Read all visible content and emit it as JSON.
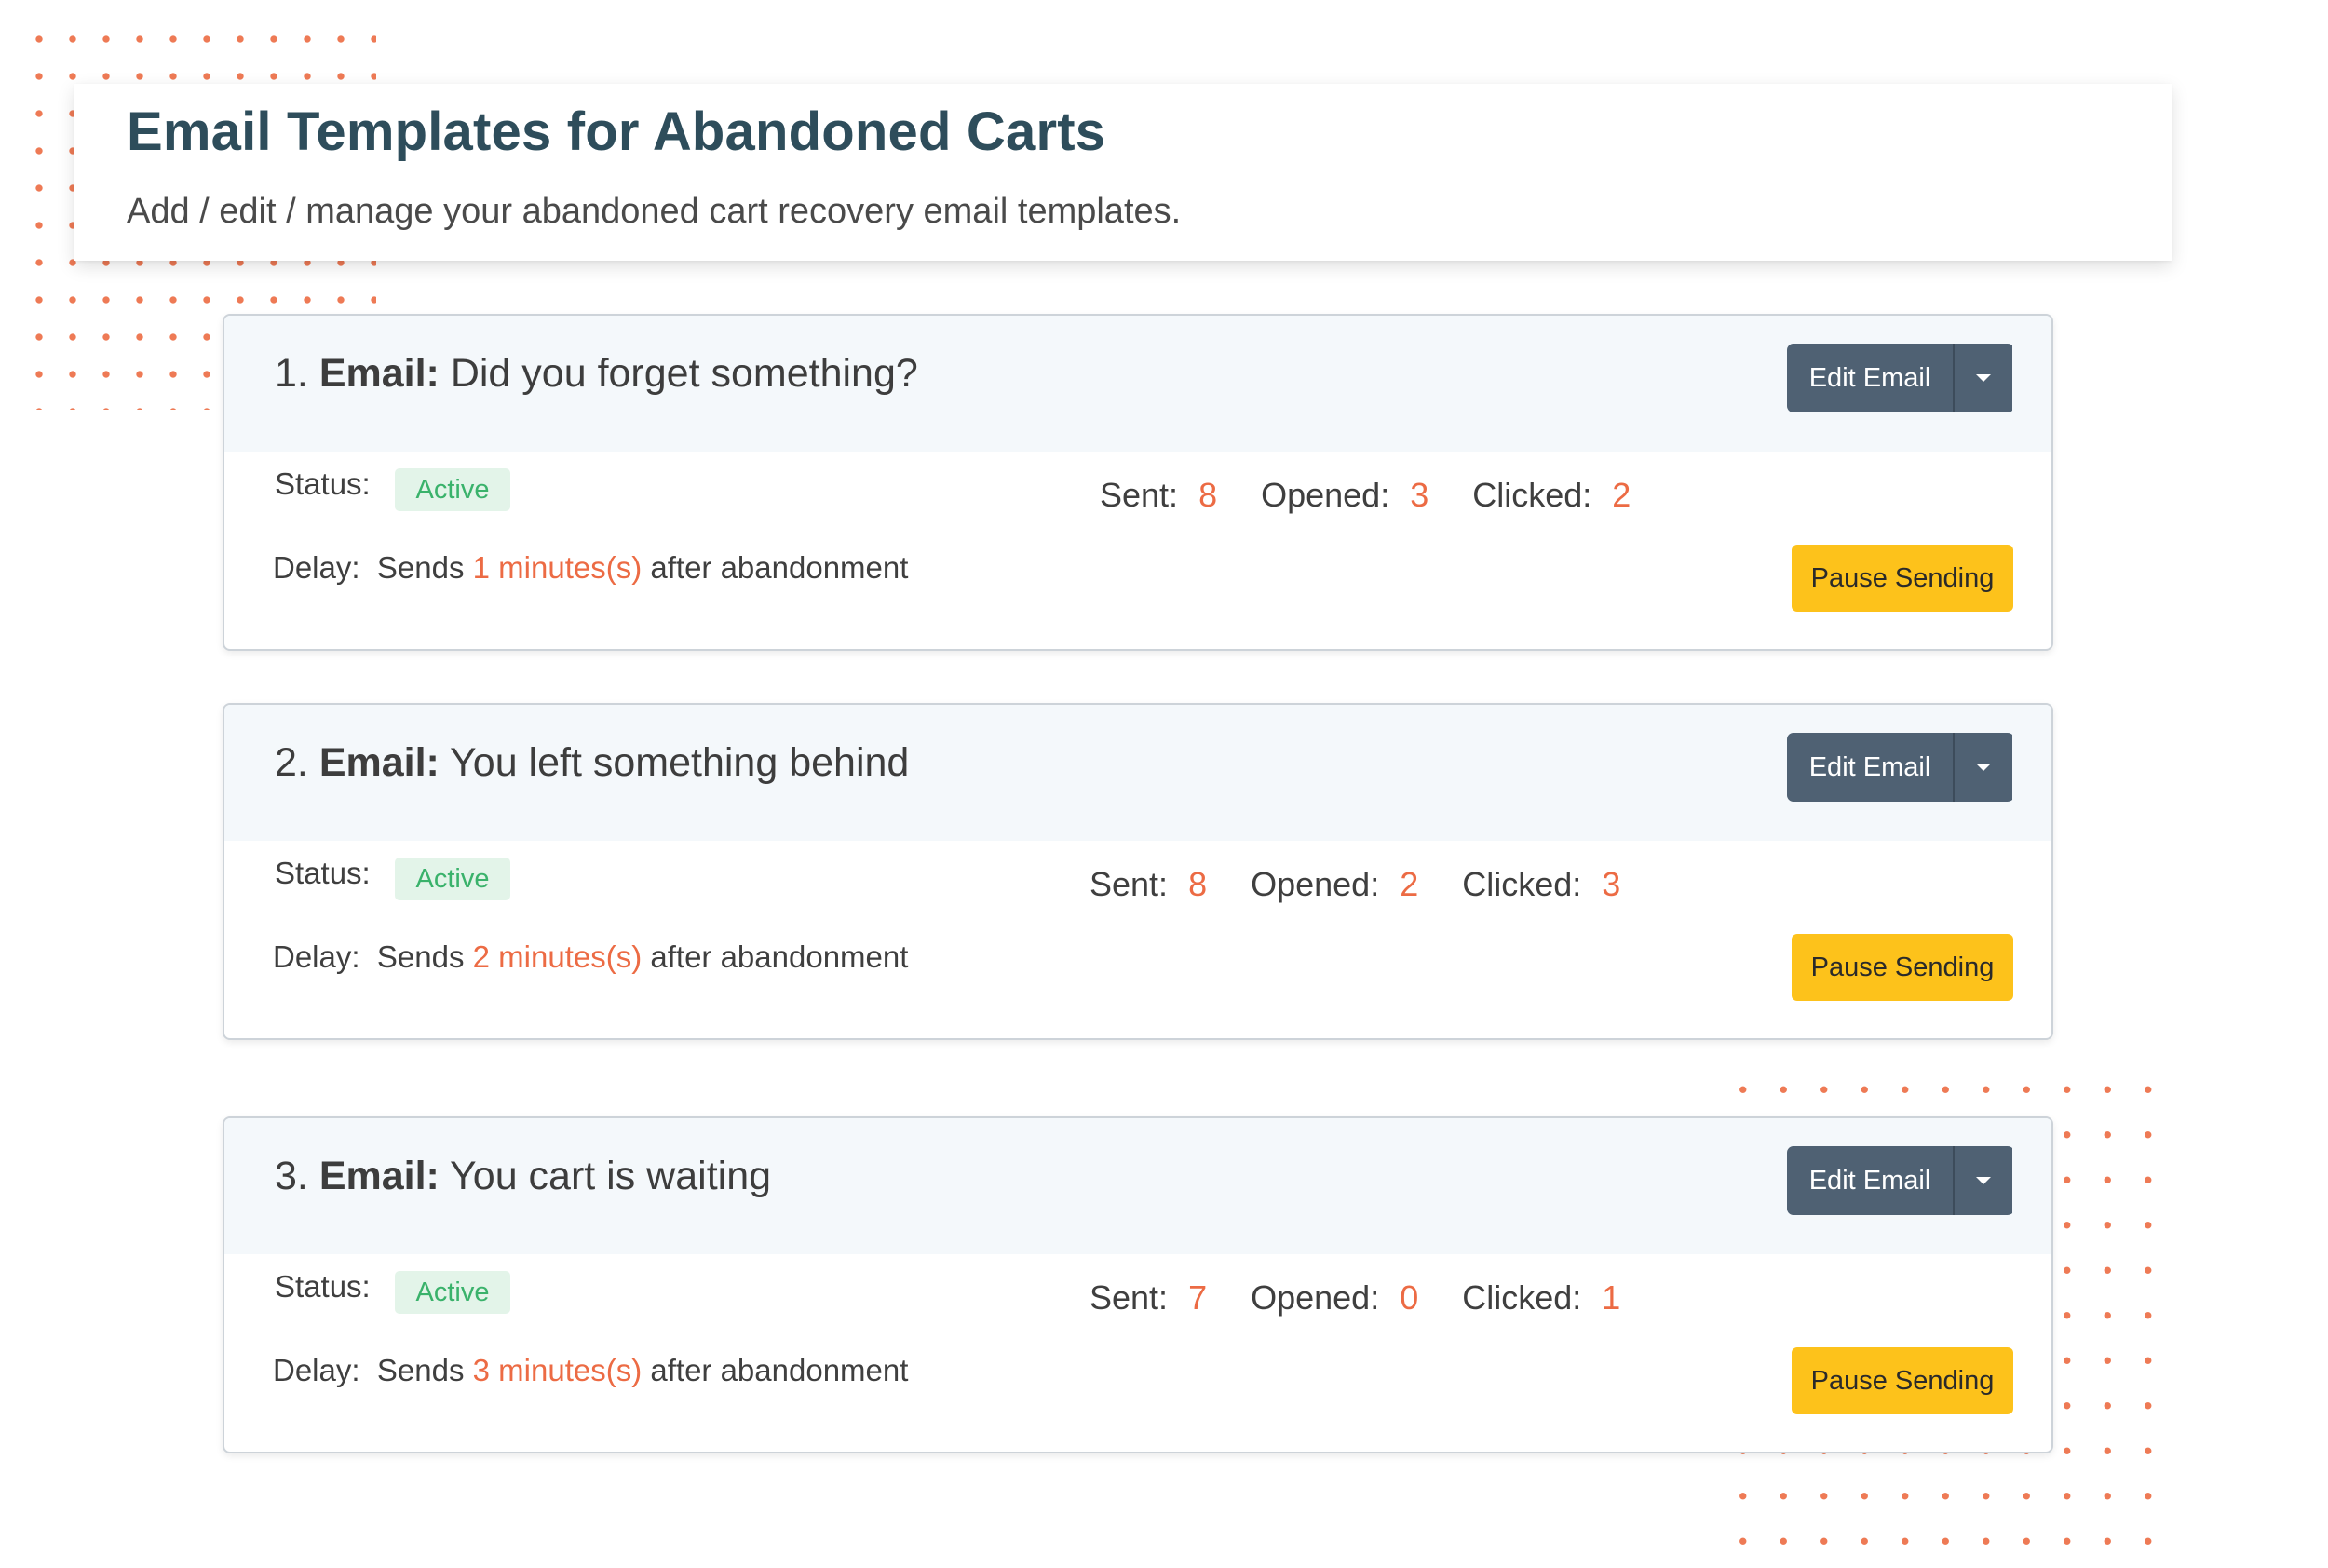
{
  "header": {
    "title": "Email Templates for Abandoned Carts",
    "subtitle": "Add / edit / manage your abandoned cart recovery email templates."
  },
  "labels": {
    "email_word": "Email:",
    "status": "Status:",
    "sent": "Sent:",
    "opened": "Opened:",
    "clicked": "Clicked:",
    "delay": "Delay:",
    "sends": "Sends",
    "after": "after abandonment",
    "edit_button": "Edit Email",
    "pause_button": "Pause Sending"
  },
  "emails": [
    {
      "number": "1.",
      "subject": "Did you forget something?",
      "status": "Active",
      "sent": "8",
      "opened": "3",
      "clicked": "2",
      "delay": "1 minutes(s)"
    },
    {
      "number": "2.",
      "subject": "You left something behind",
      "status": "Active",
      "sent": "8",
      "opened": "2",
      "clicked": "3",
      "delay": "2 minutes(s)"
    },
    {
      "number": "3.",
      "subject": "You cart is waiting",
      "status": "Active",
      "sent": "7",
      "opened": "0",
      "clicked": "1",
      "delay": "3 minutes(s)"
    }
  ],
  "colors": {
    "accent_orange": "#ec6b44",
    "title_teal": "#2e4d5b",
    "button_slate": "#4f6173",
    "button_yellow": "#fdc21b",
    "badge_green": "#3ab26b"
  },
  "icons": {
    "dropdown": "caret-down-icon"
  }
}
